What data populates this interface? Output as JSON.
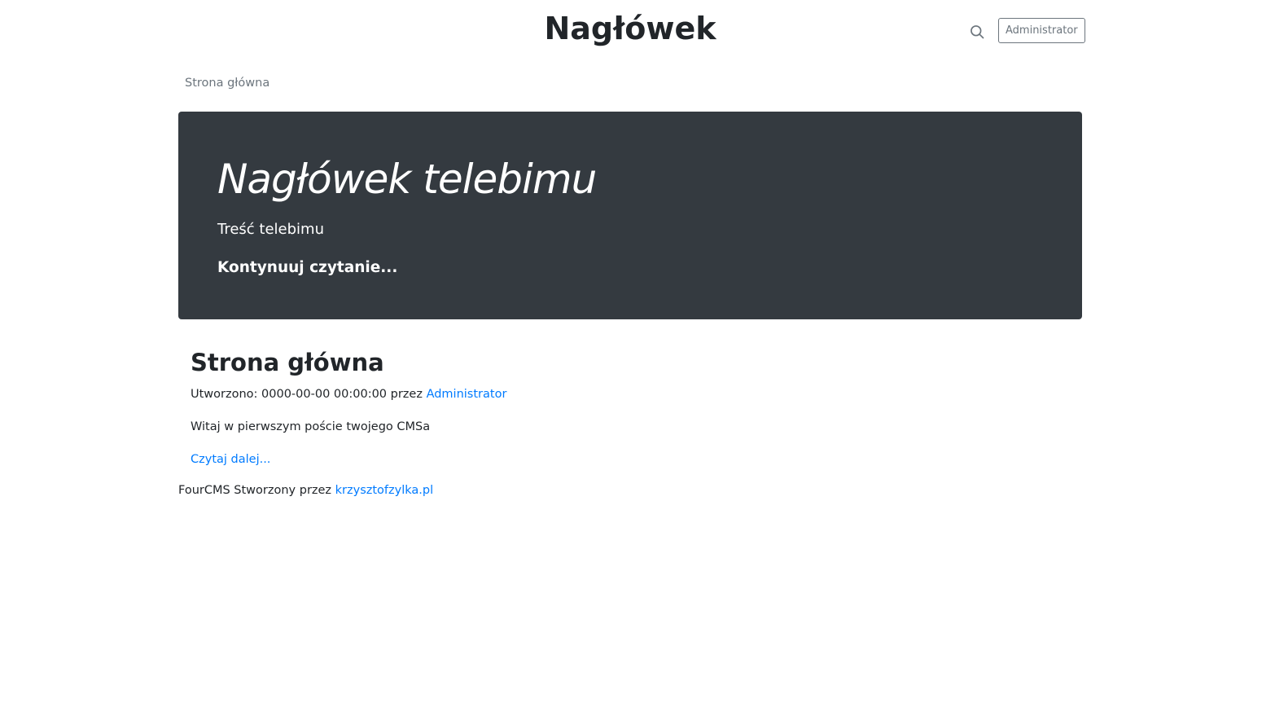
{
  "header": {
    "title": "Nagłówek",
    "search_icon": "search-icon",
    "admin_label": "Administrator"
  },
  "nav": {
    "home_label": "Strona główna"
  },
  "jumbotron": {
    "title": "Nagłówek telebimu",
    "lead": "Treść telebimu",
    "link_label": "Kontynuuj czytanie..."
  },
  "post": {
    "title": "Strona główna",
    "meta_prefix": "Utworzono: 0000-00-00 00:00:00 przez ",
    "author": "Administrator",
    "body": "Witaj w pierwszym poście twojego CMSa",
    "read_more": "Czytaj dalej..."
  },
  "footer": {
    "prefix": "FourCMS Stworzony przez ",
    "link": "krzysztofzylka.pl"
  },
  "colors": {
    "link": "#007bff",
    "jumbotron_bg": "#343a40",
    "muted": "#6c757d"
  }
}
